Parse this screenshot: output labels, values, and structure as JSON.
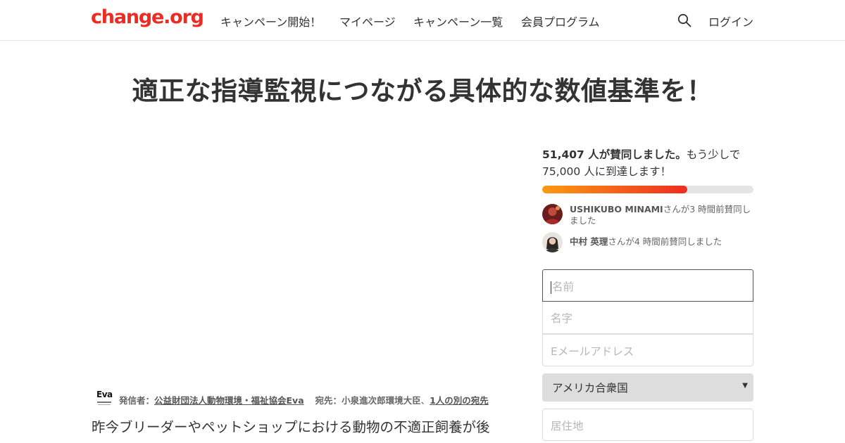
{
  "header": {
    "logo_text": "change.org",
    "nav": [
      "キャンペーン開始！",
      "マイページ",
      "キャンペーン一覧",
      "会員プログラム"
    ],
    "search_icon": "search-icon",
    "login_label": "ログイン"
  },
  "petition": {
    "title": "適正な指導監視につながる具体的な数値基準を！",
    "signatures_strong": "51,407 人が賛同しました。",
    "signatures_rest": "もう少しで",
    "goal_text": "75,000 人に到達します！",
    "progress_fraction": 0.685,
    "recent_signers": [
      {
        "name": "USHIKUBO MINAMI",
        "text": "さんが3 時間前賛同しました"
      },
      {
        "name": "中村 英理",
        "text": "さんが4 時間前賛同しました"
      }
    ]
  },
  "form": {
    "first_name_placeholder": "名前",
    "last_name_placeholder": "名字",
    "email_placeholder": "Eメールアドレス",
    "country_selected": "アメリカ合衆国",
    "address_placeholder": "居住地"
  },
  "byline": {
    "starter_label": "発信者：",
    "starter_name": "公益財団法人動物環境・福祉協会Eva",
    "recipient_label": "宛先：",
    "recipient_name": "小泉進次郎環境大臣",
    "separator": "、",
    "other_recipients": "1人の別の宛先",
    "logo_text": "Eva"
  },
  "body": {
    "intro": "昨今ブリーダーやペットショップにおける動物の不適正飼養が後"
  },
  "colors": {
    "brand": "#ec2c22",
    "progress_start": "#fb9a10",
    "progress_end": "#ee2d21"
  }
}
